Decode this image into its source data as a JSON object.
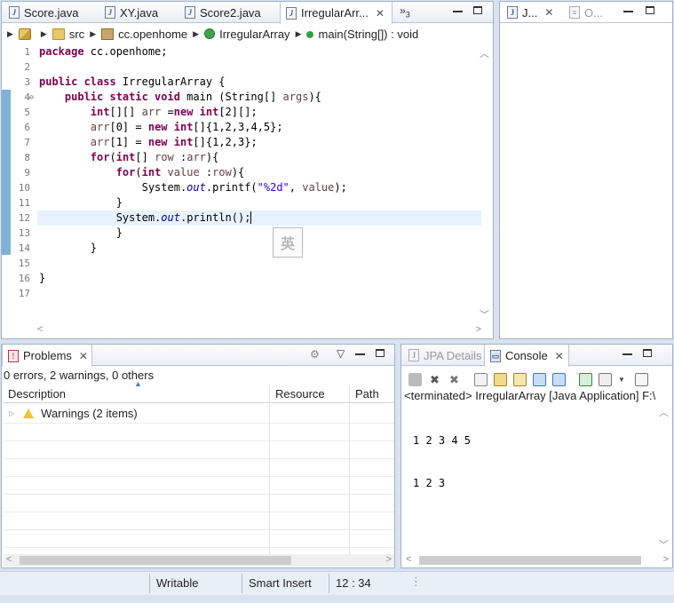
{
  "editor": {
    "tabs": [
      {
        "label": "Score.java"
      },
      {
        "label": "XY.java"
      },
      {
        "label": "Score2.java"
      },
      {
        "label": "IrregularArr..."
      }
    ],
    "overflow_count": "3",
    "breadcrumb": [
      "src",
      "cc.openhome",
      "IrregularArray",
      "main(String[]) : void"
    ],
    "ime_char": "英",
    "line_numbers": [
      "1",
      "2",
      "3",
      "4",
      "5",
      "6",
      "7",
      "8",
      "9",
      "10",
      "11",
      "12",
      "13",
      "14",
      "15",
      "16",
      "17"
    ],
    "current_line": 12
  },
  "outline": {
    "tabs": [
      {
        "label": "J..."
      },
      {
        "label": "O..."
      }
    ]
  },
  "problems": {
    "tab_label": "Problems",
    "summary": "0 errors, 2 warnings, 0 others",
    "columns": [
      "Description",
      "Resource",
      "Path"
    ],
    "rows": [
      {
        "description": "Warnings (2 items)",
        "resource": "",
        "path": ""
      }
    ]
  },
  "console": {
    "tabs": [
      {
        "label": "JPA Details"
      },
      {
        "label": "Console"
      }
    ],
    "status": "<terminated> IrregularArray [Java Application] F:\\",
    "output": [
      "1 2 3 4 5",
      "1 2 3"
    ]
  },
  "status_bar": {
    "writable": "Writable",
    "insert_mode": "Smart Insert",
    "position": "12 : 34"
  },
  "colors": {
    "keyword": "#7f0055",
    "string": "#2a00ff",
    "field": "#0000c0",
    "current_line_bg": "#e8f2fe",
    "frame_bg": "#d9e3f0",
    "warning": "#f2c230"
  }
}
